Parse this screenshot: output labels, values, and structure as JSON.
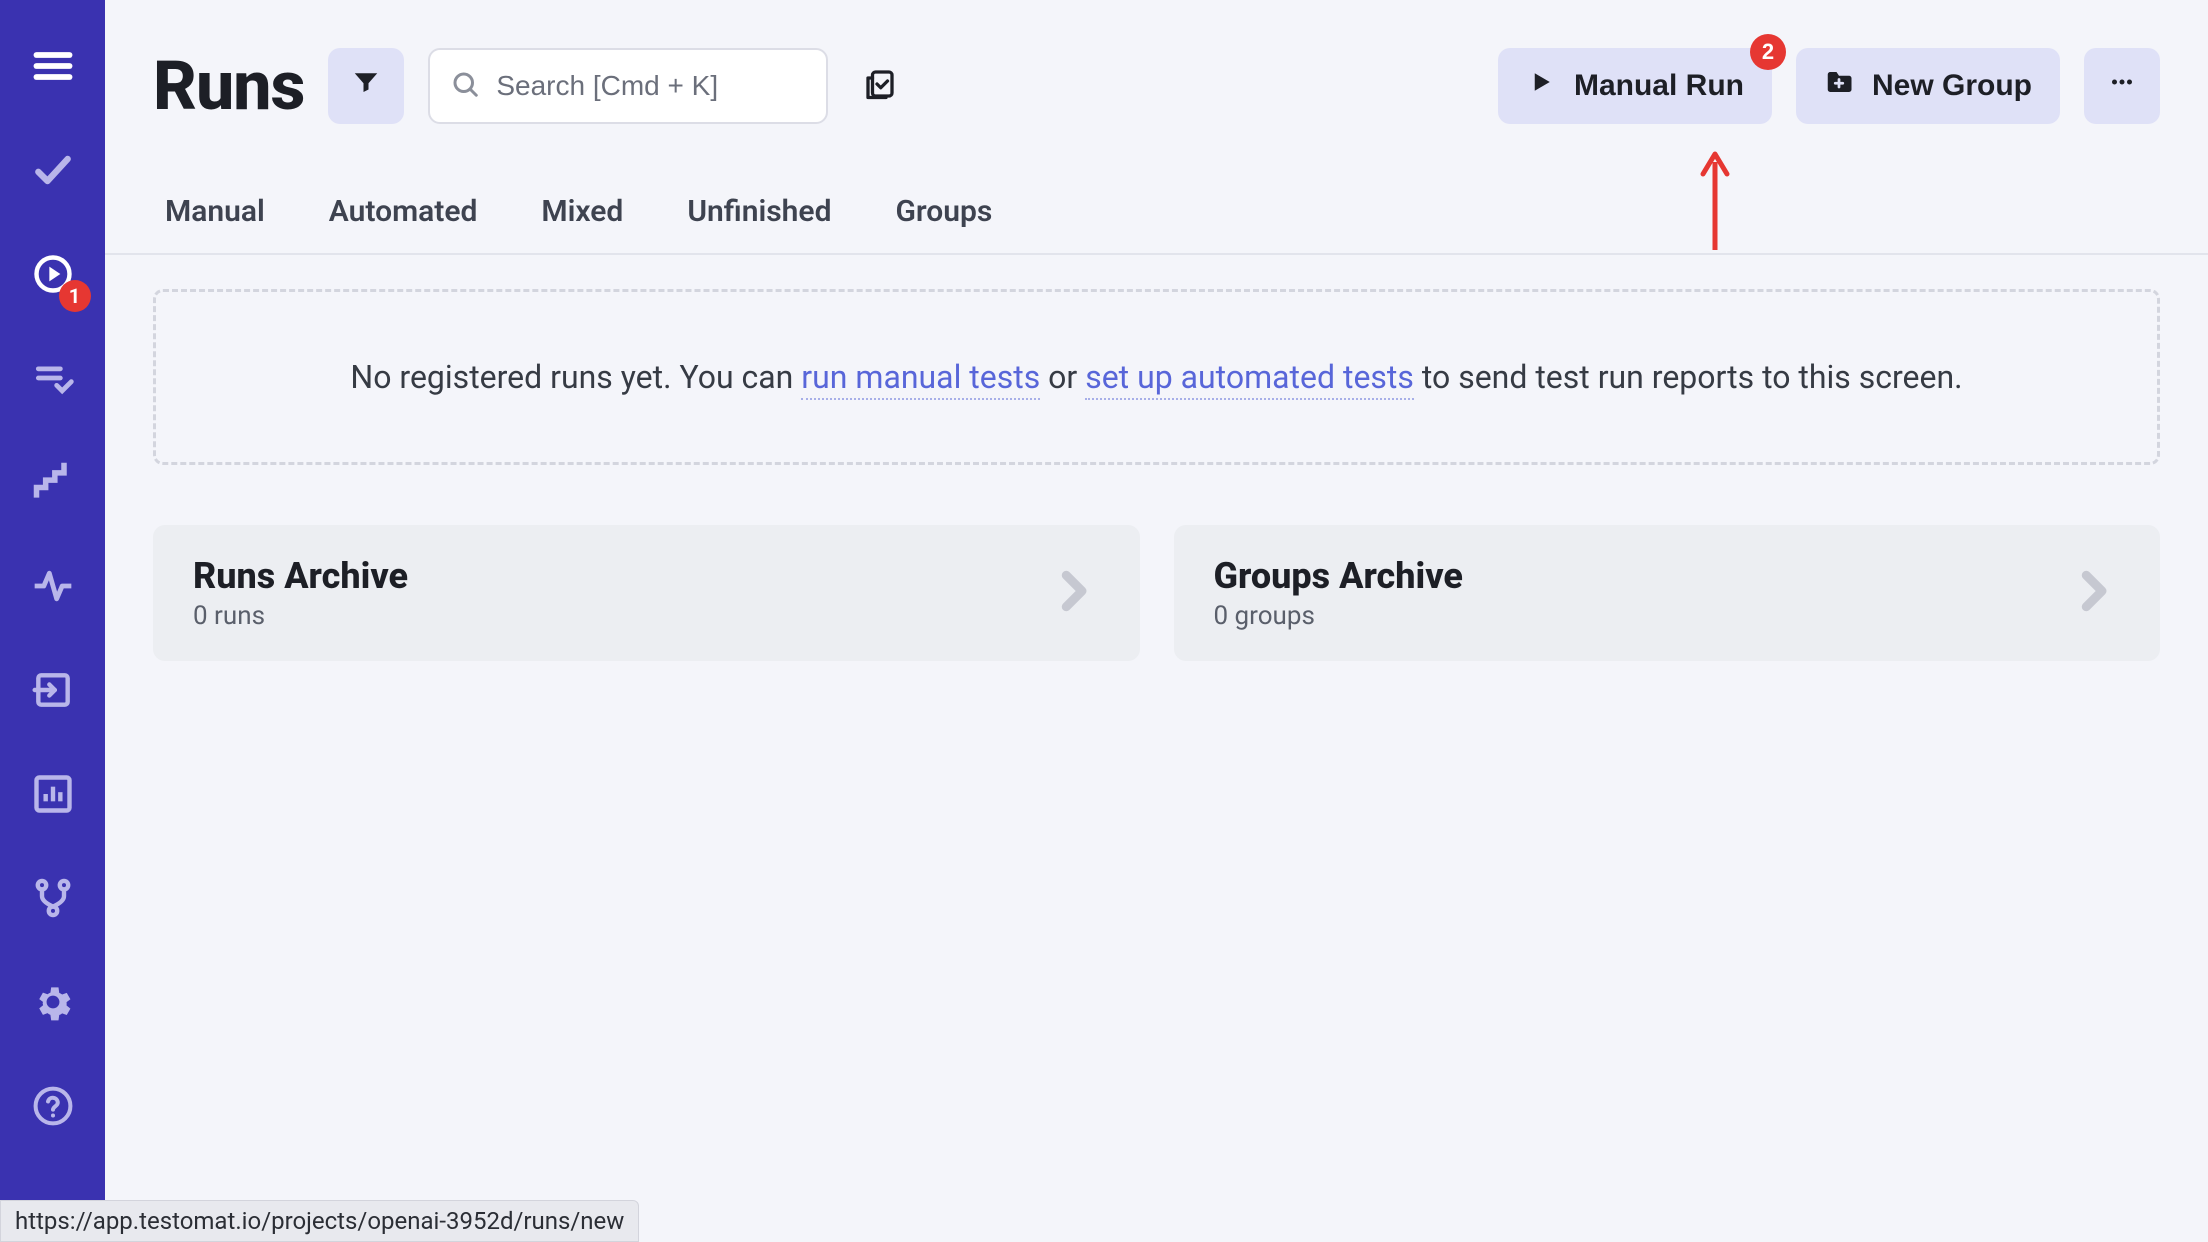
{
  "page_title": "Runs",
  "search": {
    "placeholder": "Search [Cmd + K]"
  },
  "buttons": {
    "manual_run": "Manual Run",
    "new_group": "New Group"
  },
  "badges": {
    "manual_run": "2",
    "sidebar_runs": "1"
  },
  "tabs": [
    "Manual",
    "Automated",
    "Mixed",
    "Unfinished",
    "Groups"
  ],
  "empty": {
    "pre": "No registered runs yet. You can ",
    "link1": "run manual tests",
    "mid": " or ",
    "link2": "set up automated tests",
    "post": " to send test run reports to this screen."
  },
  "cards": {
    "runs_archive": {
      "title": "Runs Archive",
      "sub": "0 runs"
    },
    "groups_archive": {
      "title": "Groups Archive",
      "sub": "0 groups"
    }
  },
  "statusbar": "https://app.testomat.io/projects/openai-3952d/runs/new",
  "sidebar": {
    "items": [
      {
        "name": "menu"
      },
      {
        "name": "tests"
      },
      {
        "name": "runs"
      },
      {
        "name": "list-check"
      },
      {
        "name": "steps"
      },
      {
        "name": "pulse"
      },
      {
        "name": "import"
      },
      {
        "name": "analytics"
      },
      {
        "name": "branches"
      },
      {
        "name": "settings"
      },
      {
        "name": "help"
      }
    ]
  }
}
